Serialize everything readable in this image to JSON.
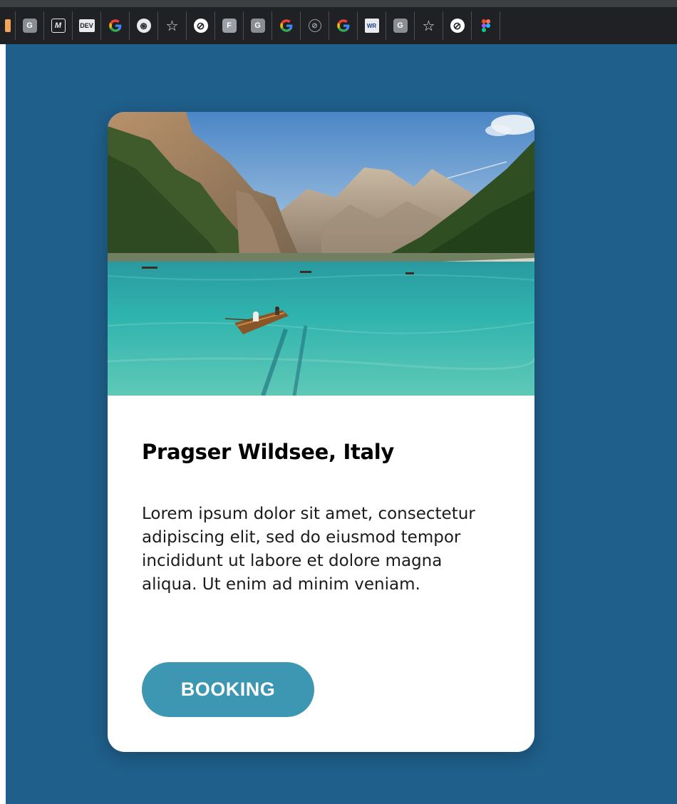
{
  "bookmarks": [
    {
      "icon": "orange-page-icon",
      "label": ""
    },
    {
      "icon": "grey-g-icon",
      "label": "G"
    },
    {
      "icon": "medium-icon",
      "label": "M"
    },
    {
      "icon": "dev-icon",
      "label": "DEV"
    },
    {
      "icon": "google-icon",
      "label": ""
    },
    {
      "icon": "openai-icon",
      "label": "֍"
    },
    {
      "icon": "star-icon",
      "label": "☆"
    },
    {
      "icon": "circle-slash-icon",
      "label": "⊘"
    },
    {
      "icon": "grey-f-icon",
      "label": "F"
    },
    {
      "icon": "grey-g-icon",
      "label": "G"
    },
    {
      "icon": "google-icon",
      "label": ""
    },
    {
      "icon": "compass-icon",
      "label": "⊘"
    },
    {
      "icon": "google-icon",
      "label": ""
    },
    {
      "icon": "wr-icon",
      "label": "WR"
    },
    {
      "icon": "grey-g-icon",
      "label": "G"
    },
    {
      "icon": "star-icon",
      "label": "☆"
    },
    {
      "icon": "circle-slash-icon",
      "label": "⊘"
    },
    {
      "icon": "figma-icon",
      "label": ""
    }
  ],
  "colors": {
    "page_background": "#1f5f8b",
    "card_background": "#ffffff",
    "button_background": "#3e97b2",
    "button_text": "#ffffff"
  },
  "card": {
    "image_icon": "lake-mountain-photo",
    "title": "Pragser Wildsee, Italy",
    "description": "Lorem ipsum dolor sit amet, consectetur adipiscing elit, sed do eiusmod tempor incididunt ut labore et dolore magna aliqua. Ut enim ad minim veniam.",
    "button_label": "BOOKING"
  }
}
